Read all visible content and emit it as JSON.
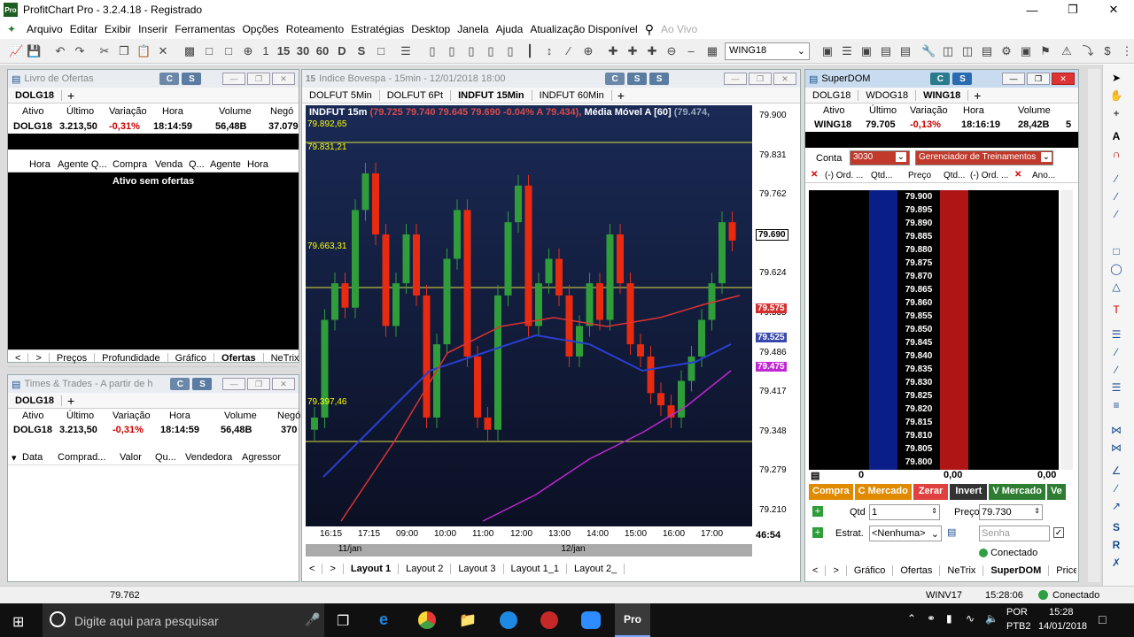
{
  "window": {
    "title": "ProfitChart Pro - 3.2.4.18 - Registrado",
    "logo": "Pro"
  },
  "menu": [
    "Arquivo",
    "Editar",
    "Exibir",
    "Inserir",
    "Ferramentas",
    "Opções",
    "Roteamento",
    "Estratégias",
    "Desktop",
    "Janela",
    "Ajuda",
    "Atualização Disponível",
    "Ao Vivo"
  ],
  "toolbar": {
    "symbol": "WING18",
    "icons": [
      "15",
      "30",
      "60",
      "D",
      "S"
    ]
  },
  "livro": {
    "title": "Livro de Ofertas",
    "btn_c": "C",
    "btn_s": "S",
    "tab_symbol": "DOLG18",
    "cols": [
      "Ativo",
      "Último",
      "Variação",
      "Hora",
      "Volume",
      "Negó"
    ],
    "row": [
      "DOLG18",
      "3.213,50",
      "-0,31%",
      "18:14:59",
      "56,48B",
      "37.079"
    ],
    "book_cols": [
      "Hora",
      "Agente Q...",
      "Compra",
      "Venda",
      "Q...",
      "Agente",
      "Hora"
    ],
    "empty": "Ativo sem ofertas",
    "tabs": [
      "Preços",
      "Profundidade",
      "Gráfico",
      "Ofertas",
      "NeTrix"
    ]
  },
  "times": {
    "title": "Times & Trades - A partir de h",
    "btn_c": "C",
    "btn_s": "S",
    "tab_symbol": "DOLG18",
    "cols": [
      "Ativo",
      "Último",
      "Variação",
      "Hora",
      "Volume",
      "Negó"
    ],
    "row": [
      "DOLG18",
      "3.213,50",
      "-0,31%",
      "18:14:59",
      "56,48B",
      "370"
    ],
    "trade_cols": [
      "Data",
      "Comprad...",
      "Valor",
      "Qu...",
      "Vendedora",
      "Agressor"
    ]
  },
  "chart": {
    "title": "Indice Bovespa - 15min - 12/01/2018 18:00",
    "btn_c": "C",
    "btn_s": "S",
    "btn_s2": "S",
    "tabs": [
      "DOLFUT 5Min",
      "DOLFUT 6Pt",
      "INDFUT 15Min",
      "INDFUT 60Min"
    ],
    "info": "INDFUT 15m",
    "info_vals": "(79.725  79.740  79.645  79.690  -0.04%  A 79.434),",
    "info_ma": "Média Móvel A [60]",
    "info_ma_val": "(79.474,",
    "hlines": [
      "79.831,21",
      "79.663,31",
      "79.397,46",
      "79.892,65"
    ],
    "yticks": [
      "79.900",
      "79.831",
      "79.762",
      "79.690",
      "79.624",
      "79.555",
      "79.486",
      "79.417",
      "79.348",
      "79.279",
      "79.210"
    ],
    "price_tags": [
      {
        "v": "79.575",
        "c": "#d32f2f"
      },
      {
        "v": "79.525",
        "c": "#3949ab"
      },
      {
        "v": "79.475",
        "c": "#c026d3"
      }
    ],
    "xticks": [
      "16:15",
      "17:15",
      "09:00",
      "10:00",
      "11:00",
      "12:00",
      "13:00",
      "14:00",
      "15:00",
      "16:00",
      "17:00"
    ],
    "countdown": "46:54",
    "dates": [
      "11/jan",
      "12/jan"
    ],
    "layouts": [
      "Layout 1",
      "Layout 2",
      "Layout 3",
      "Layout 1_1",
      "Layout 2_"
    ]
  },
  "superdom": {
    "title": "SuperDOM",
    "btn_c": "C",
    "btn_s": "S",
    "tabs": [
      "DOLG18",
      "WDOG18",
      "WING18"
    ],
    "cols": [
      "Ativo",
      "Último",
      "Variação",
      "Hora",
      "Volume"
    ],
    "row": [
      "WING18",
      "79.705",
      "-0,13%",
      "18:16:19",
      "28,42B",
      "5"
    ],
    "conta_label": "Conta",
    "conta": "3030",
    "gerenciador": "Gerenciador de Treinamentos",
    "dom_cols": [
      "(-) Ord. ...",
      "Qtd...",
      "Preço",
      "Qtd...",
      "(-) Ord. ...",
      "Ano..."
    ],
    "prices": [
      "79.900",
      "79.895",
      "79.890",
      "79.885",
      "79.880",
      "79.875",
      "79.870",
      "79.865",
      "79.860",
      "79.855",
      "79.850",
      "79.845",
      "79.840",
      "79.835",
      "79.830",
      "79.825",
      "79.820",
      "79.815",
      "79.810",
      "79.805",
      "79.800"
    ],
    "foot": [
      "0",
      "0,00",
      "0,00"
    ],
    "actions": [
      "Compra",
      "C Mercado",
      "Zerar",
      "Invert",
      "V Mercado",
      "Ve"
    ],
    "qtd_label": "Qtd",
    "qtd": "1",
    "preco_label": "Preço",
    "preco": "79.730",
    "estrat_label": "Estrat.",
    "estrat": "<Nenhuma>",
    "senha": "Senha",
    "conectado": "Conectado",
    "bottom_tabs": [
      "Gráfico",
      "Ofertas",
      "NeTrix",
      "SuperDOM",
      "PriceT"
    ]
  },
  "status": {
    "value": "79.762",
    "symbol": "WINV17",
    "time": "15:28:06",
    "conn": "Conectado"
  },
  "taskbar": {
    "search": "Digite aqui para pesquisar",
    "lang1": "POR",
    "lang2": "PTB2",
    "time": "15:28",
    "date": "14/01/2018"
  }
}
